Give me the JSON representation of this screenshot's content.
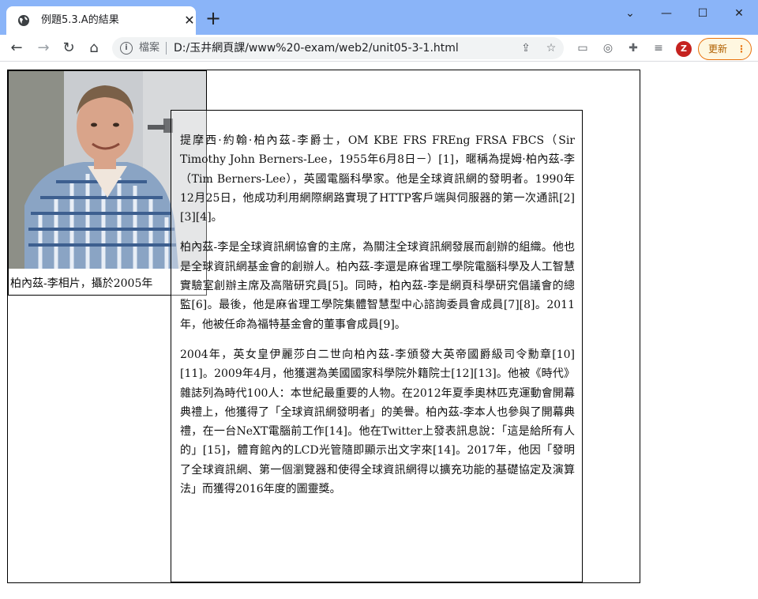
{
  "tab": {
    "title": "例題5.3.A的結果",
    "close": "✕"
  },
  "new_tab": "+",
  "window_controls": {
    "minimize": "—",
    "maximize": "☐",
    "close": "✕",
    "dropdown": "⌄"
  },
  "omnibox": {
    "label": "檔案",
    "url": "D:/玉井網頁課/www%20-exam/web2/unit05-3-1.html"
  },
  "profile_initial": "Z",
  "update_label": "更新",
  "page": {
    "caption": "柏內茲-李相片，攝於2005年",
    "paragraphs": [
      "提摩西·約翰·柏內茲-李爵士，OM KBE FRS FREng FRSA FBCS（Sir Timothy John Berners-Lee，1955年6月8日－）[1]，暱稱為提姆·柏內茲-李（Tim Berners-Lee），英國電腦科學家。他是全球資訊網的發明者。1990年12月25日，他成功利用網際網路實現了HTTP客戶端與伺服器的第一次通訊[2][3][4]。",
      "柏內茲-李是全球資訊網協會的主席，為關注全球資訊網發展而創辦的組織。他也是全球資訊網基金會的創辦人。柏內茲-李還是麻省理工學院電腦科學及人工智慧實驗室創辦主席及高階研究員[5]。同時，柏內茲-李是網頁科學研究倡議會的總監[6]。最後，他是麻省理工學院集體智慧型中心諮詢委員會成員[7][8]。2011年，他被任命為福特基金會的董事會成員[9]。",
      "2004年，英女皇伊麗莎白二世向柏內茲-李頒發大英帝國爵級司令勳章[10][11]。2009年4月，他獲選為美國國家科學院外籍院士[12][13]。他被《時代》雜誌列為時代100人：本世紀最重要的人物。在2012年夏季奧林匹克運動會開幕典禮上，他獲得了「全球資訊網發明者」的美譽。柏內茲-李本人也參與了開幕典禮，在一台NeXT電腦前工作[14]。他在Twitter上發表訊息說：「這是給所有人的」[15]，體育館內的LCD光管隨即顯示出文字來[14]。2017年，他因「發明了全球資訊網、第一個瀏覽器和使得全球資訊網得以擴充功能的基礎協定及演算法」而獲得2016年度的圖靈獎。"
    ]
  },
  "colors": {
    "titlebar": "#8ab4f8",
    "update_border": "#e8710a",
    "avatar": "#c5221f"
  }
}
